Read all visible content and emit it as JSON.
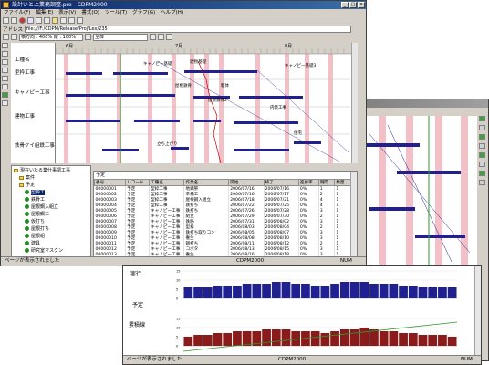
{
  "main_window": {
    "title": "設計いと上業務調整.pro - CDPM2000",
    "menu": [
      "ファイル(F)",
      "編集(E)",
      "表示(V)",
      "書式(O)",
      "ツール(T)",
      "グラフ(G)",
      "ヘルプ(H)"
    ],
    "address_label": "アドレス",
    "address_value": "file:///F:/CDPM/Release/Proj/Lex/235",
    "zoom_value": "横方向 : 400% 縦 : 100%",
    "filter_value": "全体",
    "status_text": "ページが表示されました",
    "status_app": "CDPM2000",
    "status_num": "NUM"
  },
  "gantt": {
    "header_label": "工種名",
    "months": [
      "6月",
      "7月",
      "8月"
    ],
    "tasks": [
      "型枠工事",
      "キャノピー工事",
      "建物工事",
      "鉄骨ケイ組鉄工事"
    ],
    "annotations": [
      "キャノピー基礎",
      "建物基礎",
      "屋根鉄骨",
      "躯体",
      "内装工事",
      "キャノピー基礎3",
      "屋根鉄骨2",
      "立ち上がり",
      "住宅"
    ]
  },
  "tree": {
    "items": [
      {
        "label": "現在いたる業仕事調工事",
        "type": "root"
      },
      {
        "label": "案件",
        "type": "folder"
      },
      {
        "label": "予定",
        "type": "folder"
      },
      {
        "label": "型枠工",
        "type": "leaf"
      },
      {
        "label": "鉄骨工",
        "type": "leaf"
      },
      {
        "label": "屋根鋼入組立",
        "type": "leaf"
      },
      {
        "label": "屋根鋼工",
        "type": "leaf"
      },
      {
        "label": "仮打ち",
        "type": "leaf"
      },
      {
        "label": "屋根打ち",
        "type": "leaf"
      },
      {
        "label": "屋根組",
        "type": "leaf"
      },
      {
        "label": "建具",
        "type": "leaf"
      },
      {
        "label": "研究室マスクン",
        "type": "leaf"
      },
      {
        "label": "屋根",
        "type": "leaf"
      }
    ]
  },
  "table": {
    "title": "予定",
    "columns": [
      "番号",
      "レコード",
      "工種名",
      "作業名",
      "開始",
      "終了",
      "進捗率",
      "期間",
      "数量"
    ],
    "rows": [
      [
        "00000001",
        "予定",
        "型枠工事",
        "地鎮祭",
        "2006/07/16",
        "2006/07/16",
        "0%",
        "1",
        "1"
      ],
      [
        "00000002",
        "予定",
        "型枠工事",
        "準備工",
        "2006/07/16",
        "2006/07/17",
        "0%",
        "2",
        "1"
      ],
      [
        "00000003",
        "予定",
        "型枠工事",
        "屋根鋼入組立",
        "2006/07/18",
        "2006/07/21",
        "0%",
        "4",
        "1"
      ],
      [
        "00000004",
        "予定",
        "型枠工事",
        "鉄打ち",
        "2006/07/22",
        "2006/07/25",
        "0%",
        "4",
        "1"
      ],
      [
        "00000005",
        "予定",
        "キャノピー工事",
        "鉄打ち",
        "2006/07/26",
        "2006/07/28",
        "0%",
        "3",
        "1"
      ],
      [
        "00000006",
        "予定",
        "キャノピー工事",
        "組立",
        "2006/07/29",
        "2006/07/30",
        "0%",
        "2",
        "1"
      ],
      [
        "00000007",
        "予定",
        "キャノピー工事",
        "鉄筋",
        "2006/07/31",
        "2006/08/02",
        "0%",
        "3",
        "1"
      ],
      [
        "00000008",
        "予定",
        "キャノピー工事",
        "型枠",
        "2006/08/03",
        "2006/08/04",
        "0%",
        "2",
        "1"
      ],
      [
        "00000009",
        "予定",
        "キャノピー工事",
        "鉄打ち取りコン",
        "2006/08/05",
        "2006/08/07",
        "0%",
        "3",
        "1"
      ],
      [
        "00000010",
        "予定",
        "キャノピー工事",
        "養生",
        "2006/08/08",
        "2006/08/10",
        "0%",
        "3",
        "1"
      ],
      [
        "00000011",
        "予定",
        "キャノピー工事",
        "鋼打ち",
        "2006/08/11",
        "2006/08/12",
        "0%",
        "2",
        "1"
      ],
      [
        "00000012",
        "予定",
        "キャノピー工事",
        "コボタ",
        "2006/08/13",
        "2006/08/15",
        "0%",
        "3",
        "1"
      ],
      [
        "00000013",
        "予定",
        "キャノピー工事",
        "養生",
        "2006/08/16",
        "2006/08/18",
        "0%",
        "3",
        "1"
      ],
      [
        "00000014",
        "予定",
        "キャノピー工事",
        "鋼打ち",
        "2006/08/19",
        "2006/08/21",
        "0%",
        "3",
        "1"
      ]
    ]
  },
  "chart_window": {
    "labels": [
      "実行",
      "予定",
      "累積線"
    ],
    "status_text": "ページが表示されました",
    "status_app": "CDPM2000",
    "status_num": "NUM"
  },
  "colors": {
    "titlebar": "#0a246a",
    "bar_blue": "#202090",
    "bar_red": "#8b1a1a",
    "holiday_pink": "#f4c0c8",
    "line_green": "#2a9a2a"
  },
  "chart_data": {
    "type": "bar",
    "series": [
      {
        "name": "実行",
        "values": [
          6,
          6,
          6,
          7,
          7,
          7,
          8,
          8,
          8,
          9,
          9,
          8,
          8,
          7,
          7,
          8,
          9,
          9,
          9,
          8,
          8,
          8,
          7,
          7,
          6,
          6,
          6,
          6
        ]
      },
      {
        "name": "予定",
        "values": [
          5,
          6,
          6,
          7,
          7,
          8,
          8,
          8,
          9,
          9,
          9,
          8,
          8,
          8,
          7,
          8,
          9,
          9,
          10,
          9,
          8,
          8,
          7,
          7,
          6,
          6,
          6,
          5
        ]
      }
    ],
    "ylim": [
      0,
      15
    ]
  }
}
